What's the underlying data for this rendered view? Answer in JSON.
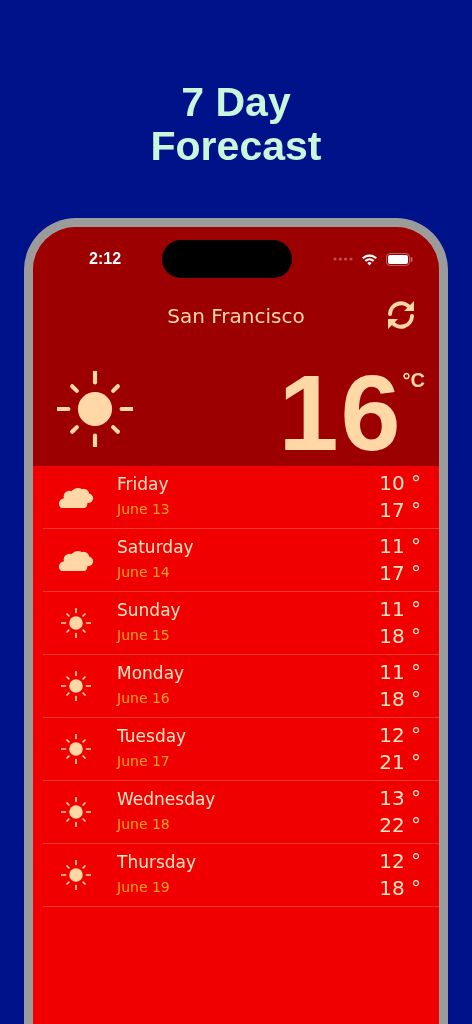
{
  "title": [
    "7 Day",
    "Forecast"
  ],
  "status_bar": {
    "time": "2:12"
  },
  "city": "San Francisco",
  "current": {
    "kind": "sun",
    "temperature": "16",
    "unit": "°C"
  },
  "days": [
    {
      "kind": "cloud",
      "day": "Friday",
      "date": "June 13",
      "low": "10 °",
      "high": "17 °"
    },
    {
      "kind": "cloud",
      "day": "Saturday",
      "date": "June 14",
      "low": "11 °",
      "high": "17 °"
    },
    {
      "kind": "sun",
      "day": "Sunday",
      "date": "June 15",
      "low": "11 °",
      "high": "18 °"
    },
    {
      "kind": "sun",
      "day": "Monday",
      "date": "June 16",
      "low": "11 °",
      "high": "18 °"
    },
    {
      "kind": "sun",
      "day": "Tuesday",
      "date": "June 17",
      "low": "12 °",
      "high": "21 °"
    },
    {
      "kind": "sun",
      "day": "Wednesday",
      "date": "June 18",
      "low": "13 °",
      "high": "22 °"
    },
    {
      "kind": "sun",
      "day": "Thursday",
      "date": "June 19",
      "low": "12 °",
      "high": "18 °"
    }
  ]
}
